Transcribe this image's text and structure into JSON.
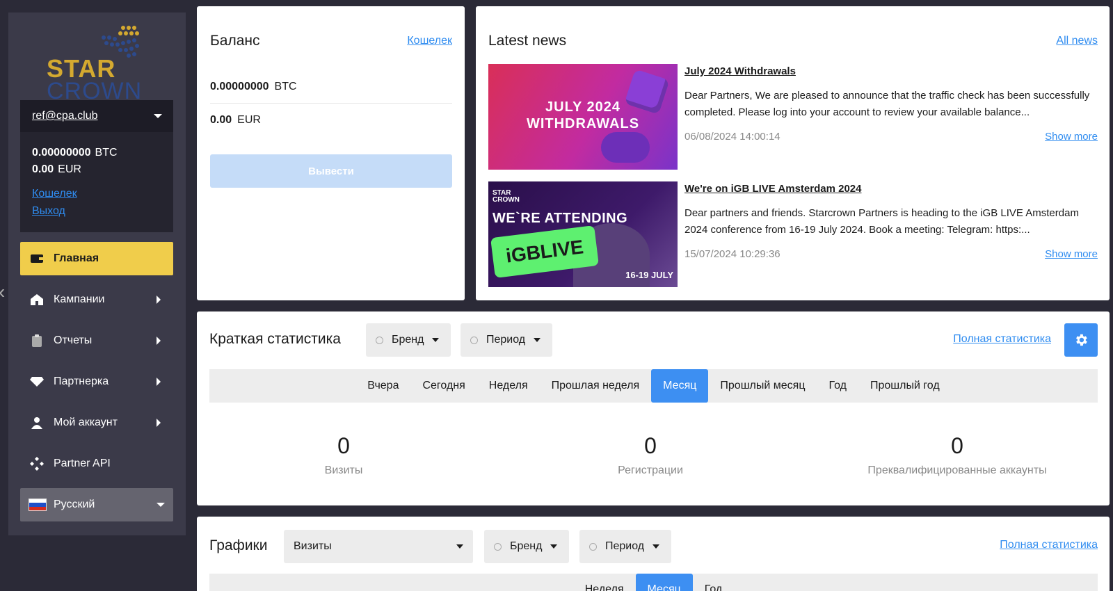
{
  "brand": {
    "line1": "STAR",
    "line2": "CROWN"
  },
  "account": {
    "email": "ref@cpa.club",
    "btc": "0.00000000",
    "btc_unit": "BTC",
    "eur": "0.00",
    "eur_unit": "EUR",
    "wallet_link": "Кошелек",
    "logout_link": "Выход"
  },
  "nav": {
    "home": "Главная",
    "campaigns": "Кампании",
    "reports": "Отчеты",
    "partner": "Партнерка",
    "my_account": "Мой аккаунт",
    "api": "Partner API",
    "language": "Русский"
  },
  "balance": {
    "title": "Баланс",
    "wallet_link": "Кошелек",
    "btc": "0.00000000",
    "btc_unit": "BTC",
    "eur": "0.00",
    "eur_unit": "EUR",
    "withdraw": "Вывести"
  },
  "news": {
    "title": "Latest news",
    "all_link": "All news",
    "items": [
      {
        "image_text_1": "JULY 2024",
        "image_text_2": "WITHDRAWALS",
        "title": "July 2024 Withdrawals",
        "text": "Dear Partners,   We are pleased to announce that the traffic check has been successfully completed. Please log into your account to review your available balance...",
        "date": "06/08/2024 14:00:14",
        "more": "Show more"
      },
      {
        "image_logo_1": "STAR",
        "image_logo_2": "CROWN",
        "image_title": "WE`RE ATTENDING",
        "image_badge": "iGBLIVE",
        "image_date": "16-19 JULY",
        "title": "We're on iGB LIVE Amsterdam 2024",
        "text": "Dear partners and friends.   Starcrown Partners is heading to the iGB LIVE Amsterdam 2024 conference from 16-19 July 2024.   Book a meeting:   Telegram: https:...",
        "date": "15/07/2024 10:29:36",
        "more": "Show more"
      }
    ]
  },
  "stats": {
    "title": "Краткая статистика",
    "brand": "Бренд",
    "period": "Период",
    "full_link": "Полная статистика",
    "tabs": [
      "Вчера",
      "Сегодня",
      "Неделя",
      "Прошлая неделя",
      "Месяц",
      "Прошлый месяц",
      "Год",
      "Прошлый год"
    ],
    "active_tab": "Месяц",
    "metrics": [
      {
        "value": "0",
        "label": "Визиты"
      },
      {
        "value": "0",
        "label": "Регистрации"
      },
      {
        "value": "0",
        "label": "Преквалифицированные аккаунты"
      }
    ]
  },
  "graphs": {
    "title": "Графики",
    "metric": "Визиты",
    "brand": "Бренд",
    "period": "Период",
    "full_link": "Полная статистика",
    "tabs": [
      "Неделя",
      "Месяц",
      "Год"
    ],
    "active_tab": "Месяц"
  },
  "colors": {
    "accent_yellow": "#f0cd4b",
    "accent_blue": "#3d8ff2",
    "sidebar_bg": "#3b3a49",
    "page_bg": "#2b2a37"
  }
}
